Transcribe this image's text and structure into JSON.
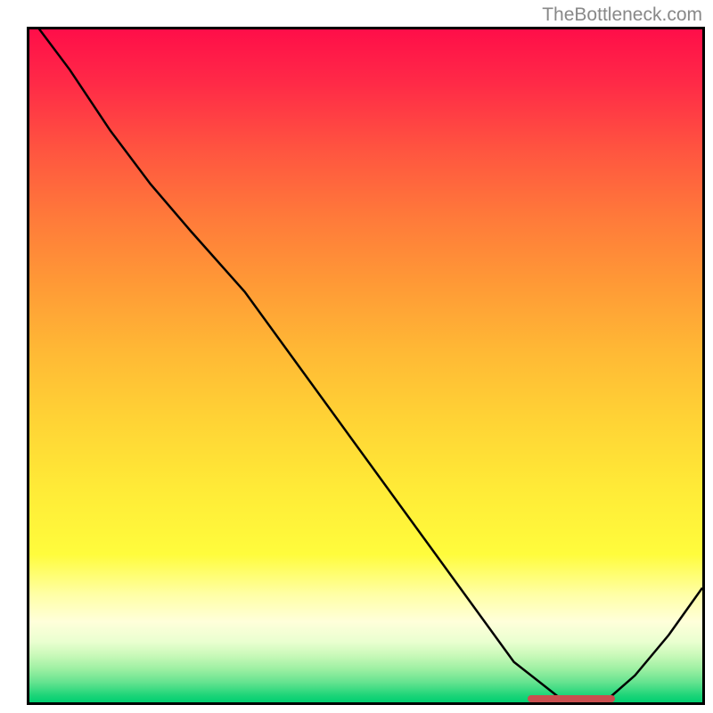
{
  "watermark": "TheBottleneck.com",
  "chart_data": {
    "type": "line",
    "title": "",
    "xlabel": "",
    "ylabel": "",
    "xlim": [
      0,
      100
    ],
    "ylim": [
      0,
      100
    ],
    "curve": {
      "x": [
        0,
        6,
        12,
        18,
        24,
        32,
        40,
        48,
        56,
        64,
        72,
        79,
        82,
        86,
        90,
        95,
        100
      ],
      "y": [
        102,
        94,
        85,
        77,
        70,
        61,
        50,
        39,
        28,
        17,
        6,
        0.5,
        0.5,
        0.5,
        4,
        10,
        17
      ]
    },
    "marker": {
      "x_start": 74,
      "x_end": 87,
      "y": 0.5,
      "color": "#c94f4f"
    },
    "gradient_colors": [
      "#ff0e49",
      "#00cf71"
    ]
  }
}
